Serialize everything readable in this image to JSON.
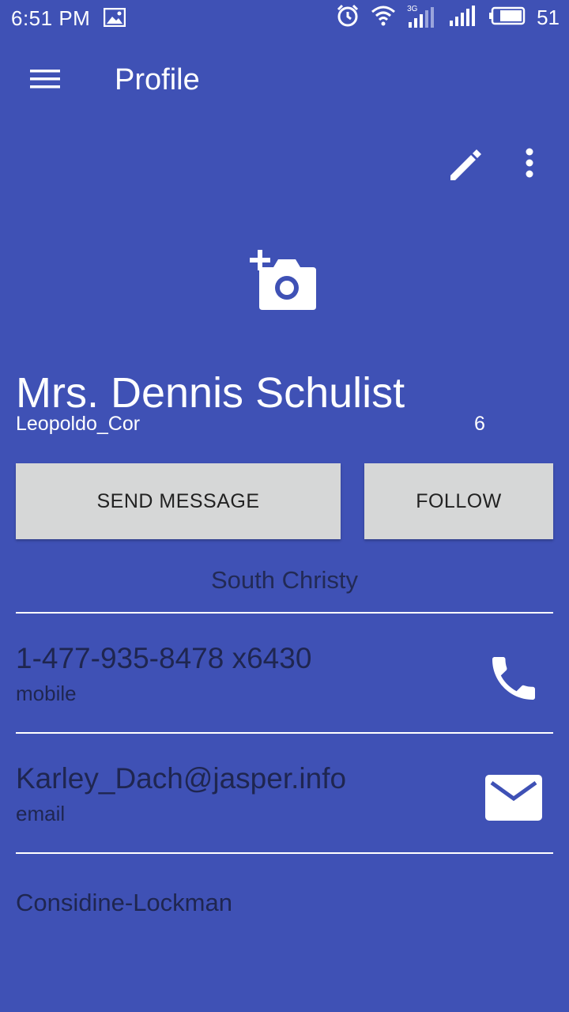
{
  "status_bar": {
    "time": "6:51 PM",
    "network": "3G",
    "battery": "51",
    "icons": [
      "image-icon",
      "alarm-icon",
      "wifi-icon",
      "signal-3g-icon",
      "signal-icon",
      "battery-icon"
    ]
  },
  "app_bar": {
    "title": "Profile",
    "menu_icon": "menu-icon",
    "edit_icon": "edit-pencil-icon",
    "more_icon": "more-vert-icon"
  },
  "profile": {
    "photo_icon": "add-photo-camera-icon",
    "name": "Mrs. Dennis Schulist",
    "username": "Leopoldo_Cor",
    "count": "6",
    "location": "South Christy",
    "company": "Considine-Lockman"
  },
  "actions": {
    "send_message": "SEND MESSAGE",
    "follow": "FOLLOW"
  },
  "contacts": {
    "phone": {
      "value": "1-477-935-8478 x6430",
      "type": "mobile",
      "icon": "phone-icon"
    },
    "email": {
      "value": "Karley_Dach@jasper.info",
      "type": "email",
      "icon": "email-icon"
    }
  },
  "colors": {
    "background": "#3F51B5",
    "button": "#D6D7D7",
    "dark_text": "#1F2650",
    "white": "#FFFFFF"
  }
}
